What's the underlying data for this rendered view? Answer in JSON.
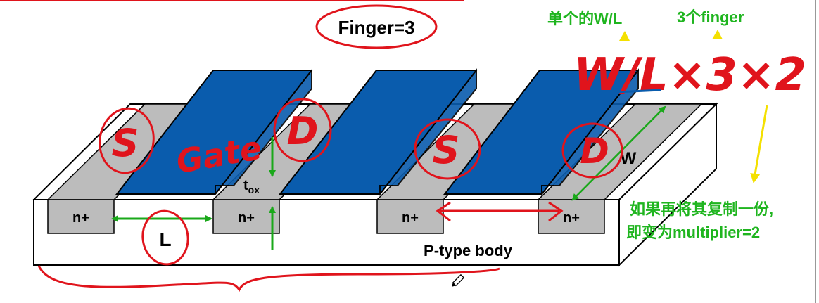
{
  "labels": {
    "n_plus": "n+",
    "body": "P-type body",
    "tox_base": "t",
    "tox_sub": "ox",
    "length": "L",
    "width": "W"
  },
  "annotations": {
    "finger_count": "Finger=3",
    "single_wl": "单个的W/L",
    "three_fingers": "3个finger",
    "formula": "W/L×3×2",
    "note_line1": "如果再将其复制一份,",
    "note_line2": "即变为multiplier=2",
    "hand_s": "S",
    "hand_d": "D",
    "hand_gate": "Gate"
  },
  "colors": {
    "gate_blue": "#0a5cad",
    "diffusion_gray": "#bcbcbc",
    "ink_red": "#e0141c",
    "arrow_green": "#1aa81a",
    "text_green": "#1fb51f",
    "arrow_yellow": "#f4e000"
  }
}
